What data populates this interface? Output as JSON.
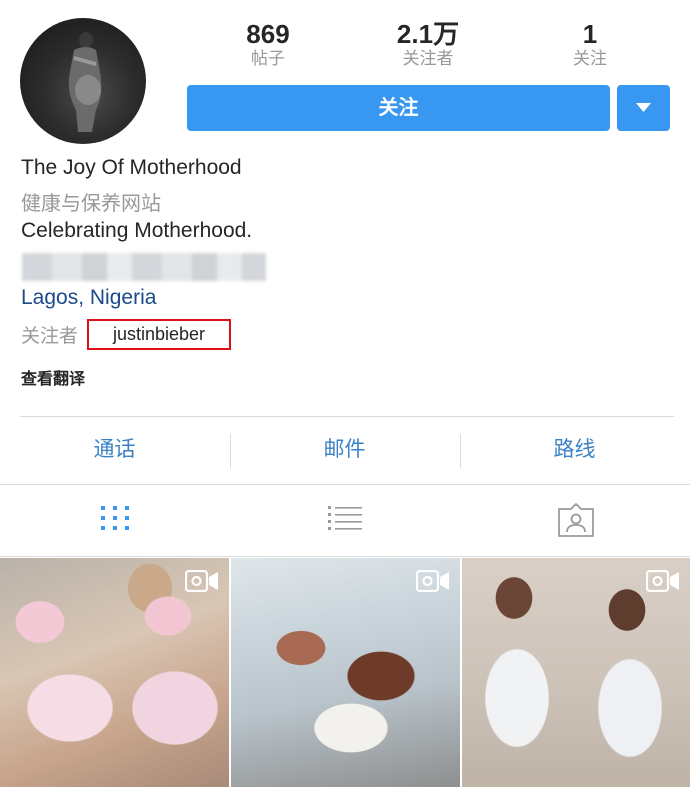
{
  "profile": {
    "avatar_icon": "profile-photo",
    "stats": {
      "posts": {
        "value": "869",
        "label": "帖子"
      },
      "followers": {
        "value": "2.1万",
        "label": "关注者"
      },
      "following": {
        "value": "1",
        "label": "关注"
      }
    },
    "follow_label": "关注",
    "dropdown_icon": "triangle-down-icon"
  },
  "bio": {
    "name": "The Joy Of Motherhood",
    "category": "健康与保养网站",
    "text": "Celebrating Motherhood.",
    "location": "Lagos, Nigeria",
    "followed_by_label": "关注者",
    "followed_by_user": "justinbieber",
    "see_translation": "查看翻译"
  },
  "contact": {
    "call": "通话",
    "email": "邮件",
    "directions": "路线"
  },
  "tabs": [
    "grid-icon",
    "list-icon",
    "tagged-icon"
  ],
  "photos": [
    "video-icon",
    "video-icon",
    "video-icon"
  ],
  "colors": {
    "accent": "#3897f0",
    "link": "#3b82c4",
    "highlight": "#e0101a"
  }
}
